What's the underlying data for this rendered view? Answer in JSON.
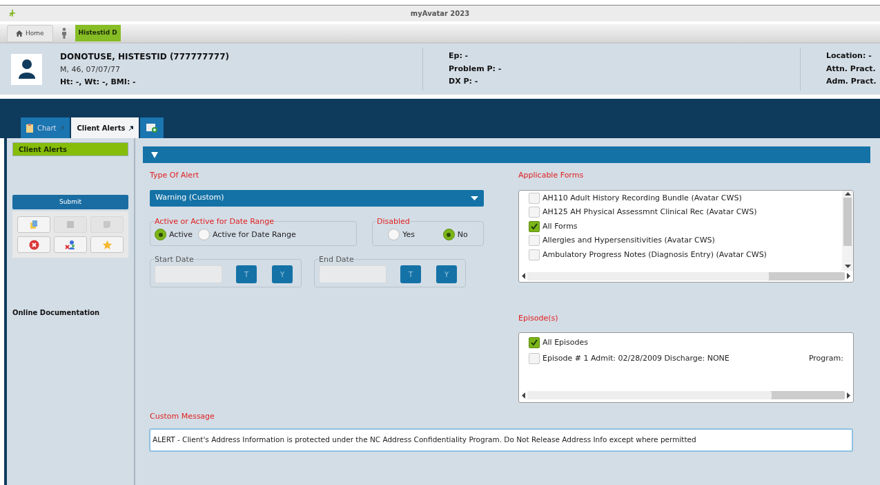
{
  "window": {
    "title": "myAvatar 2023"
  },
  "nav_tabs": [
    {
      "label": "Home",
      "selected": false
    },
    {
      "label": "Histestid D",
      "selected": true
    }
  ],
  "patient": {
    "name": "DONOTUSE, HISTESTID (777777777)",
    "demographics": "M, 46, 07/07/77",
    "vitals": "Ht: -, Wt: -, BMI: -",
    "episode_info": [
      "Ep: -",
      "Problem P: -",
      "DX P: -"
    ],
    "practice_info": [
      "Location: -",
      "Attn. Pract.",
      "Adm. Pract."
    ]
  },
  "chart_tabs": [
    {
      "label": "Chart",
      "selected": false
    },
    {
      "label": "Client Alerts",
      "selected": true
    }
  ],
  "sidebar": {
    "items": [
      {
        "label": "Client Alerts",
        "selected": true
      }
    ],
    "submit": "Submit",
    "toolbar": [
      {
        "kind": "docs",
        "disabled": false
      },
      {
        "kind": "square",
        "disabled": true
      },
      {
        "kind": "note",
        "disabled": true
      },
      {
        "kind": "cancel",
        "disabled": false
      },
      {
        "kind": "people",
        "disabled": false
      },
      {
        "kind": "star",
        "disabled": false
      }
    ],
    "link": "Online Documentation"
  },
  "form": {
    "type_of_alert": {
      "label": "Type Of Alert",
      "value": "Warning (Custom)"
    },
    "active_group": {
      "legend": "Active or Active for Date Range",
      "options": [
        {
          "label": "Active",
          "selected": true
        },
        {
          "label": "Active for Date Range",
          "selected": false
        }
      ]
    },
    "disabled_group": {
      "legend": "Disabled",
      "options": [
        {
          "label": "Yes",
          "selected": false
        },
        {
          "label": "No",
          "selected": true
        }
      ]
    },
    "date_fields": [
      {
        "legend": "Start Date",
        "buttons": [
          "T",
          "Y"
        ]
      },
      {
        "legend": "End Date",
        "buttons": [
          "T",
          "Y"
        ]
      }
    ],
    "applicable_forms": {
      "label": "Applicable Forms",
      "items": [
        {
          "label": "AH110 Adult History Recording Bundle (Avatar CWS)",
          "checked": false
        },
        {
          "label": "AH125 AH Physical Assessmnt Clinical Rec (Avatar CWS)",
          "checked": false
        },
        {
          "label": "All Forms",
          "checked": true
        },
        {
          "label": "Allergies and Hypersensitivities (Avatar CWS)",
          "checked": false
        },
        {
          "label": "Ambulatory Progress Notes (Diagnosis Entry) (Avatar CWS)",
          "checked": false
        }
      ]
    },
    "episodes": {
      "label": "Episode(s)",
      "items": [
        {
          "label": "All Episodes",
          "checked": true
        },
        {
          "label": "Episode # 1 Admit: 02/28/2009 Discharge: NONE",
          "checked": false,
          "program": "Program:"
        }
      ]
    },
    "custom_message": {
      "label": "Custom Message",
      "value": "ALERT - Client's Address Information is protected under the NC Address Confidentiality Program. Do Not Release Address Info except where permitted"
    }
  }
}
